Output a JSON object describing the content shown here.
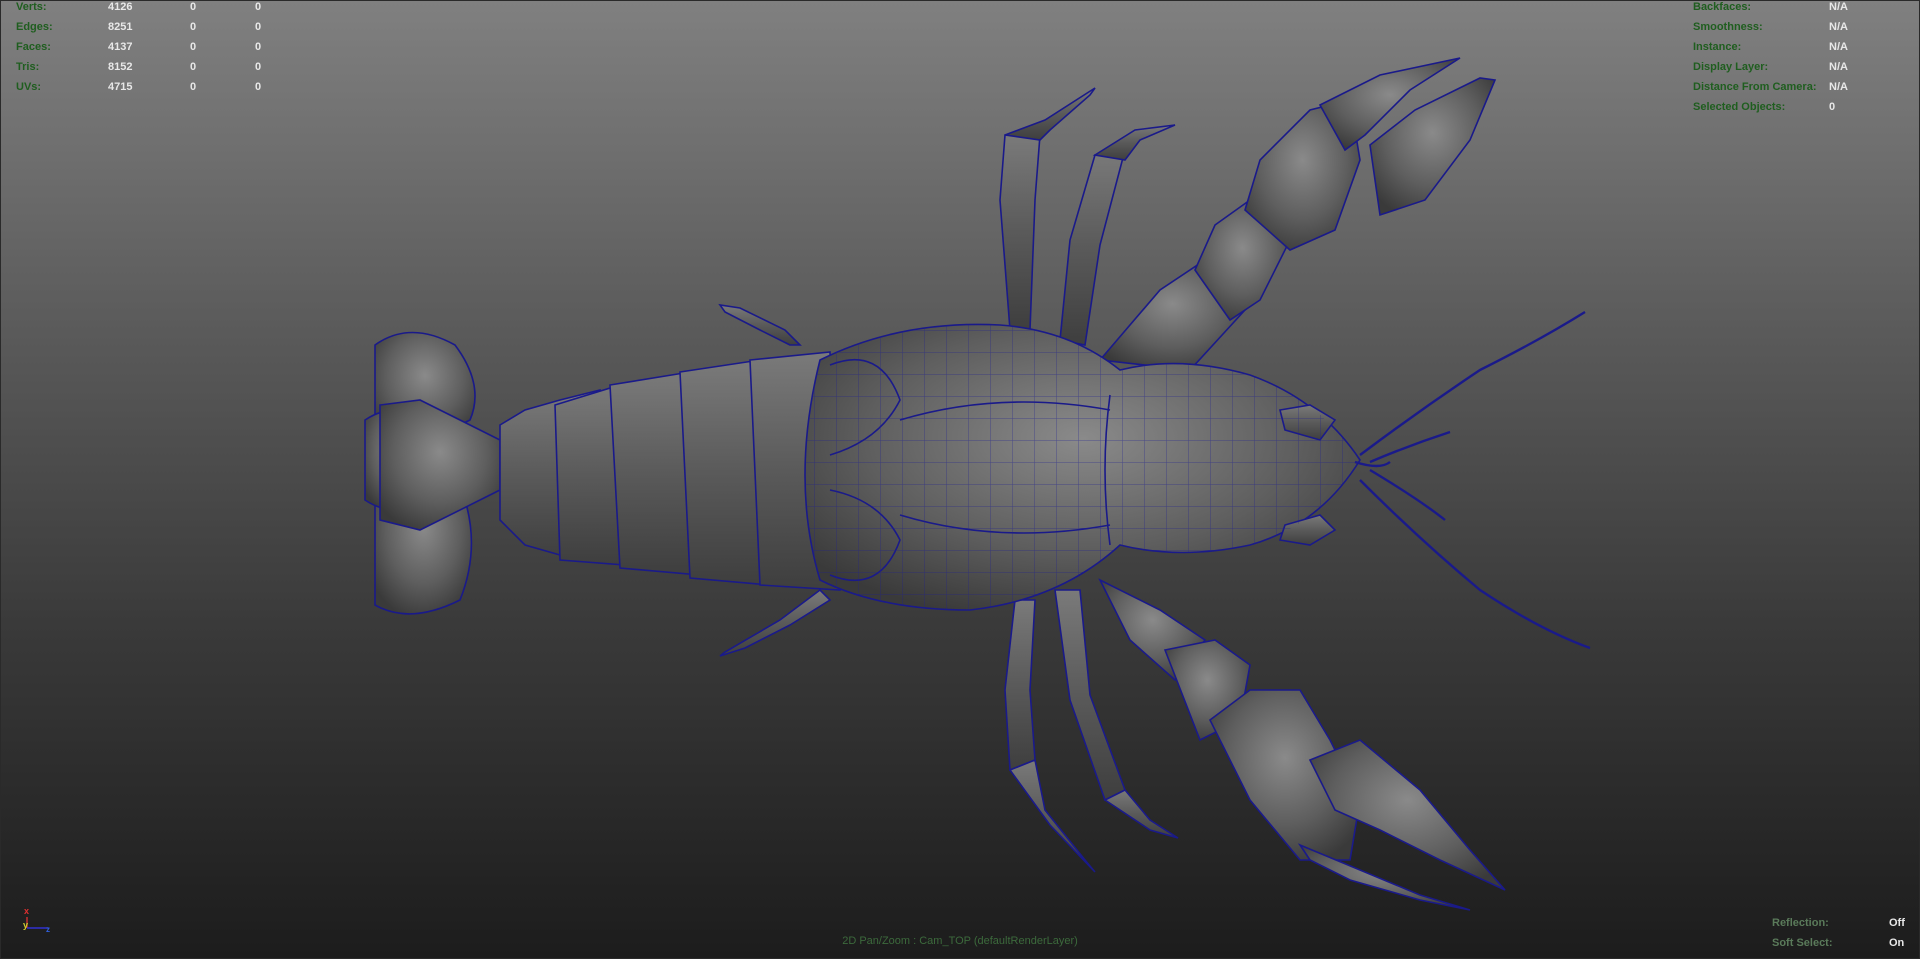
{
  "heads_up": {
    "poly_count": [
      {
        "label": "Verts:",
        "values": [
          "4126",
          "0",
          "0"
        ]
      },
      {
        "label": "Edges:",
        "values": [
          "8251",
          "0",
          "0"
        ]
      },
      {
        "label": "Faces:",
        "values": [
          "4137",
          "0",
          "0"
        ]
      },
      {
        "label": "Tris:",
        "values": [
          "8152",
          "0",
          "0"
        ]
      },
      {
        "label": "UVs:",
        "values": [
          "4715",
          "0",
          "0"
        ]
      }
    ],
    "object_details": [
      {
        "label": "Backfaces:",
        "value": "N/A"
      },
      {
        "label": "Smoothness:",
        "value": "N/A"
      },
      {
        "label": "Instance:",
        "value": "N/A"
      },
      {
        "label": "Display Layer:",
        "value": "N/A"
      },
      {
        "label": "Distance From Camera:",
        "value": "N/A"
      },
      {
        "label": "Selected Objects:",
        "value": "0"
      }
    ],
    "viewport_status": [
      {
        "label": "Reflection:",
        "value": "Off"
      },
      {
        "label": "Soft Select:",
        "value": "On"
      }
    ],
    "camera": "2D Pan/Zoom : Cam_TOP (defaultRenderLayer)"
  },
  "axis_gizmo": {
    "x": "x",
    "y": "y",
    "z": "z"
  },
  "colors": {
    "hud_label": "#1f5e1f",
    "hud_value": "#e8e8e8",
    "wireframe": "#1a1a8a",
    "mesh_fill": "#646464"
  }
}
